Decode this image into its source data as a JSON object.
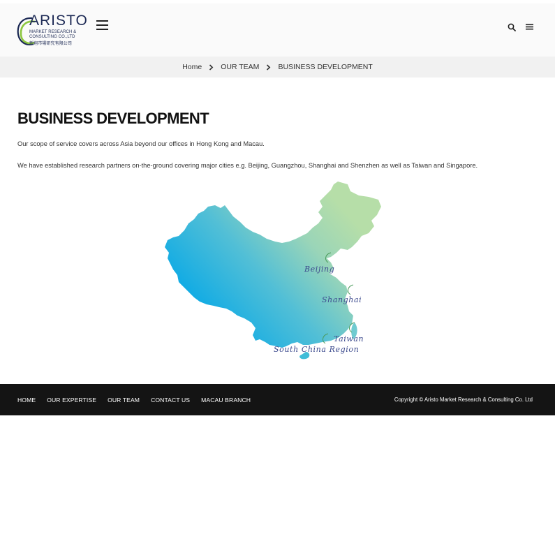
{
  "header": {
    "logo": {
      "word": "ARISTO",
      "line1": "MARKET RESEARCH &",
      "line2": "CONSULTING CO.,LTD",
      "line3": "新翔市場研究有限公司"
    }
  },
  "breadcrumb": {
    "items": [
      "Home",
      "OUR TEAM",
      "BUSINESS DEVELOPMENT"
    ]
  },
  "main": {
    "title": "BUSINESS DEVELOPMENT",
    "paragraphs": [
      "Our scope of service covers across Asia beyond our offices in Hong Kong and Macau.",
      "We have established research partners on-the-ground covering major cities e.g. Beijing, Guangzhou, Shanghai and Shenzhen as well as Taiwan and Singapore."
    ],
    "map_labels": {
      "beijing": "Beijing",
      "shanghai": "Shanghai",
      "taiwan": "Taiwan",
      "south_china": "South China Region"
    }
  },
  "footer": {
    "nav": [
      "HOME",
      "OUR EXPERTISE",
      "OUR TEAM",
      "CONTACT US",
      "MACAU BRANCH"
    ],
    "copyright": "Copyright © Aristo Market Research & Consulting Co. Ltd"
  },
  "colors": {
    "logo_navy": "#1d2a55",
    "logo_green": "#8cc63f",
    "map_blue": "#00a6e8",
    "map_green": "#b6dea8",
    "footer_bg": "#141414",
    "breadcrumb_bg": "#f1f1f1"
  }
}
